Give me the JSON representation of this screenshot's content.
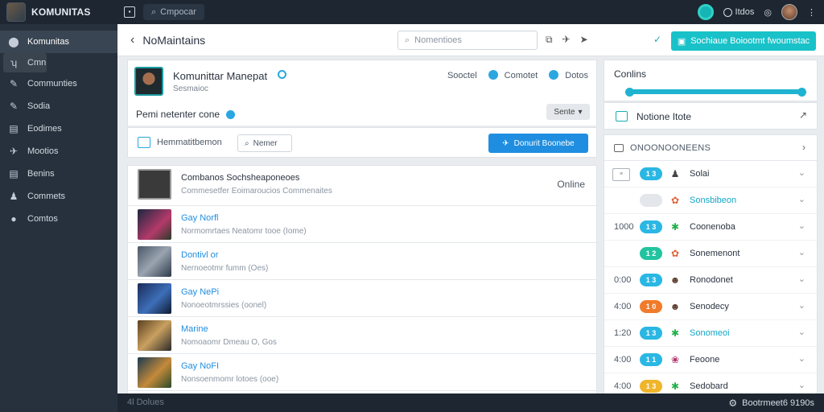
{
  "app": {
    "name": "KOMUNITAS"
  },
  "topbar": {
    "search_label": "Cmpocar",
    "time": "Itdos"
  },
  "sidebar": {
    "items": [
      {
        "label": "Komunitas",
        "icon": "shield-icon"
      },
      {
        "label": "Cmn",
        "icon": "people-icon"
      },
      {
        "label": "Communties",
        "icon": "wrench-icon"
      },
      {
        "label": "Sodia",
        "icon": "wrench-icon"
      },
      {
        "label": "Eodimes",
        "icon": "list-icon"
      },
      {
        "label": "Mootios",
        "icon": "plane-icon"
      },
      {
        "label": "Benins",
        "icon": "list-icon"
      },
      {
        "label": "Commets",
        "icon": "people-icon"
      },
      {
        "label": "Comtos",
        "icon": "globe-icon"
      }
    ]
  },
  "header": {
    "title": "NoMaintains",
    "search_placeholder": "Nomentioes",
    "cta": "Sochiaue Boiootmt fwoumstac"
  },
  "profile": {
    "name": "Komunittar Manepat",
    "subtitle": "Sesmaioc",
    "links": [
      "Sooctel",
      "Comotet",
      "Dotos"
    ],
    "section": "Pemi netenter cone",
    "select": "Sente"
  },
  "toolbar": {
    "label": "Hemmatitbemon",
    "search": "Nemer",
    "button": "Donurit Boonebe"
  },
  "posts": [
    {
      "title": "Combanos Sochsheaponeoes",
      "sub": "Commesetfer Eoimaroucios Commenaites",
      "status": "Online",
      "title_dark": true
    },
    {
      "title": "Gay Norfl",
      "sub": "Normomrtaes Neatomr tooe (Iome)",
      "status": ""
    },
    {
      "title": "Dontivl or",
      "sub": "Nernoeotmr fumm (Oes)",
      "status": ""
    },
    {
      "title": "Gay NePi",
      "sub": "Nonoeotmrssies (oonel)",
      "status": ""
    },
    {
      "title": "Marine",
      "sub": "Nomoaomr Dmeau O, Gos",
      "status": ""
    },
    {
      "title": "Gay NoFI",
      "sub": "Nonsoenmomr lotoes (ooe)",
      "status": ""
    },
    {
      "title": "4l Dolues",
      "sub": "",
      "status": ""
    }
  ],
  "online_panel": {
    "title": "Conlins",
    "progress": 0.98
  },
  "notif_panel": {
    "label": "Notione Itote"
  },
  "members": {
    "header": "ONOONOONEENS",
    "rows": [
      {
        "time": "",
        "pill": "1 3",
        "pill_color": "#2ab7e3",
        "name": "Solai",
        "icon": "people-icon",
        "teal": false
      },
      {
        "time": "",
        "pill": "",
        "pill_color": "#e3e6ea",
        "name": "Sonsbibeon",
        "icon": "badge-icon",
        "teal": true
      },
      {
        "time": "1000",
        "pill": "1 3",
        "pill_color": "#2ab7e3",
        "name": "Coonenoba",
        "icon": "gear-icon",
        "teal": false
      },
      {
        "time": "",
        "pill": "1 2",
        "pill_color": "#22c4a0",
        "name": "Sonemenont",
        "icon": "badge-icon",
        "teal": false
      },
      {
        "time": "0:00",
        "pill": "1 3",
        "pill_color": "#2ab7e3",
        "name": "Ronodonet",
        "icon": "avatar-icon",
        "teal": false
      },
      {
        "time": "4:00",
        "pill": "1 0",
        "pill_color": "#f07b2a",
        "name": "Senodecy",
        "icon": "avatar-icon",
        "teal": false
      },
      {
        "time": "1:20",
        "pill": "1 3",
        "pill_color": "#2ab7e3",
        "name": "Sonomeoi",
        "icon": "gear-icon",
        "teal": true
      },
      {
        "time": "4:00",
        "pill": "1 1",
        "pill_color": "#2ab7e3",
        "name": "Feoone",
        "icon": "flower-icon",
        "teal": false
      },
      {
        "time": "4:00",
        "pill": "1 3",
        "pill_color": "#f0b52a",
        "name": "Sedobard",
        "icon": "gear-icon",
        "teal": false
      }
    ]
  },
  "footer": {
    "ghost": "4l Dolues",
    "status": "Bootrmeet6 9190s"
  },
  "colors": {
    "accent": "#19c2c9",
    "primary": "#1f8ee0",
    "dark": "#1d2631",
    "sidebar": "#27313d"
  }
}
